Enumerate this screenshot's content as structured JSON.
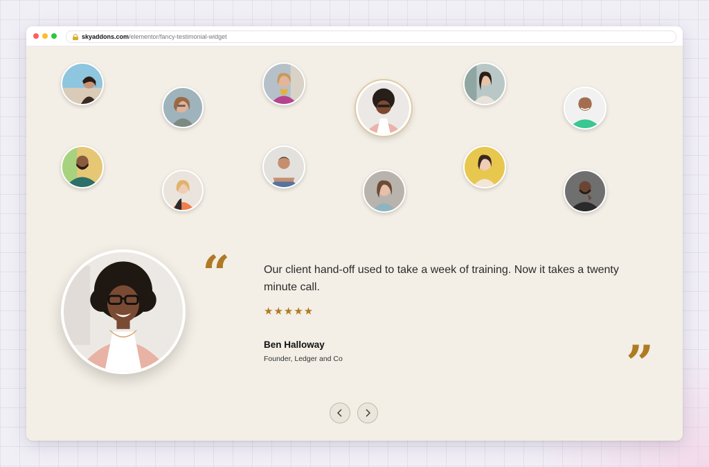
{
  "browser": {
    "url_domain": "skyaddons.com",
    "url_path": "/elementor/fancy-testimonial-widget"
  },
  "colors": {
    "accent": "#b07a25",
    "page_background": "#f3efe6",
    "window_dots": [
      "#fe5f57",
      "#febc2e",
      "#28c840"
    ]
  },
  "avatars": [
    {
      "person": "woman-dark-hair-beach"
    },
    {
      "person": "woman-glasses-curly"
    },
    {
      "person": "older-woman-pink"
    },
    {
      "person": "woman-curly-glasses-pink-blazer",
      "active": true
    },
    {
      "person": "woman-long-hair"
    },
    {
      "person": "man-green-shirt"
    },
    {
      "person": "man-teal-shirt"
    },
    {
      "person": "woman-blonde-orange"
    },
    {
      "person": "man-blue-shirt-arms-crossed"
    },
    {
      "person": "woman-brown-hair"
    },
    {
      "person": "woman-yellow-background"
    },
    {
      "person": "man-dark-shirt"
    }
  ],
  "testimonial": {
    "text": "Our client hand-off used to take a week of training. Now it takes a twenty minute call.",
    "rating": 5,
    "stars": "★★★★★",
    "author": "Ben Halloway",
    "role": "Founder, Ledger and Co"
  },
  "icons": {
    "quote_open": "quote-open-icon",
    "quote_close": "quote-close-icon",
    "prev": "chevron-left-icon",
    "next": "chevron-right-icon"
  }
}
